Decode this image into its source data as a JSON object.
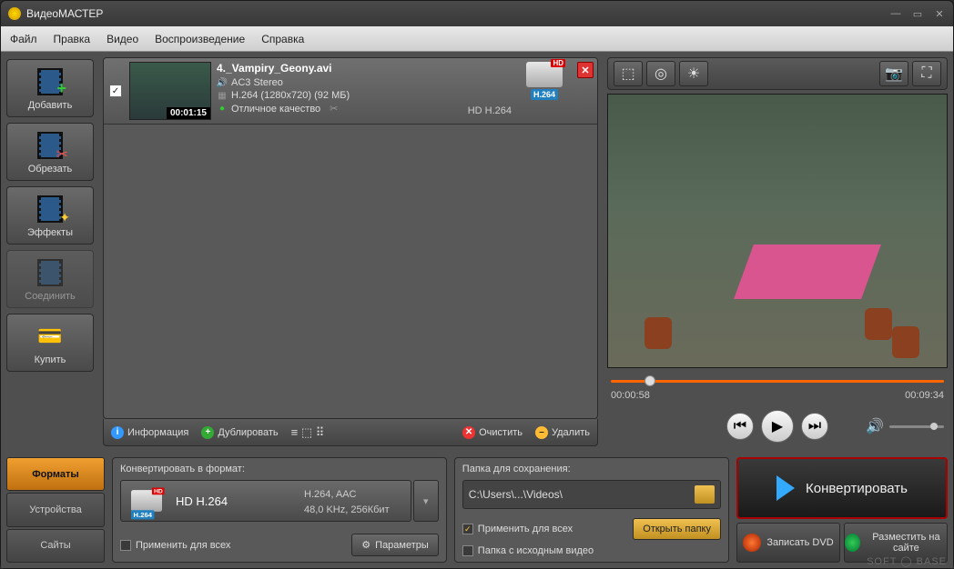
{
  "title": "ВидеоМАСТЕР",
  "menu": {
    "file": "Файл",
    "edit": "Правка",
    "video": "Видео",
    "play": "Воспроизведение",
    "help": "Справка"
  },
  "sidebar": {
    "add": "Добавить",
    "crop": "Обрезать",
    "effects": "Эффекты",
    "merge": "Соединить",
    "buy": "Купить"
  },
  "file": {
    "name": "4._Vampiry_Geony.avi",
    "audio": "AC3 Stereo",
    "codec": "H.264 (1280x720) (92 МБ)",
    "quality": "Отличное качество",
    "duration": "00:01:15",
    "format_text": "HD H.264",
    "badge": "H.264",
    "hd": "HD"
  },
  "listbar": {
    "info": "Информация",
    "dup": "Дублировать",
    "clear": "Очистить",
    "delete": "Удалить"
  },
  "player": {
    "current": "00:00:58",
    "total": "00:09:34"
  },
  "tabs": {
    "formats": "Форматы",
    "devices": "Устройства",
    "sites": "Сайты"
  },
  "convert_panel": {
    "title": "Конвертировать в формат:",
    "format": "HD H.264",
    "codec_line1": "H.264, AAC",
    "codec_line2": "48,0 KHz, 256Кбит",
    "apply_all": "Применить для всех",
    "params": "Параметры",
    "badge": "H.264"
  },
  "save_panel": {
    "title": "Папка для сохранения:",
    "path": "C:\\Users\\...\\Videos\\",
    "apply_all": "Применить для всех",
    "source_folder": "Папка с исходным видео",
    "open": "Открыть папку"
  },
  "actions": {
    "convert": "Конвертировать",
    "dvd": "Записать DVD",
    "upload": "Разместить на сайте"
  },
  "watermark": "SOFT ◯ BASE"
}
